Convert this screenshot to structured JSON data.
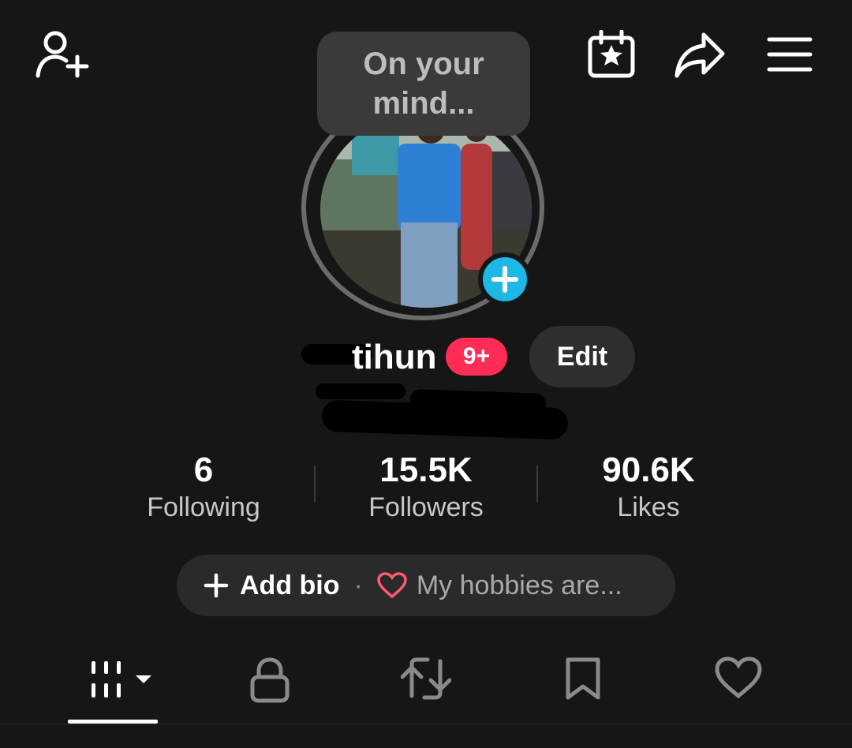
{
  "top_bar": {
    "add_friend_icon": "person-plus-icon",
    "calendar_icon": "calendar-star-icon",
    "share_icon": "share-arrow-icon",
    "menu_icon": "hamburger-menu-icon"
  },
  "note_bubble": {
    "line1": "On your",
    "line2": "mind..."
  },
  "avatar": {
    "add_icon": "plus-icon",
    "add_color": "#1db8e6"
  },
  "profile": {
    "name_visible": "tihun",
    "notification_badge": "9+",
    "badge_color": "#ff2c55",
    "edit_label": "Edit"
  },
  "stats": [
    {
      "value": "6",
      "label": "Following"
    },
    {
      "value": "15.5K",
      "label": "Followers"
    },
    {
      "value": "90.6K",
      "label": "Likes"
    }
  ],
  "bio": {
    "add_label": "Add bio",
    "separator": "·",
    "hobbies_text": "My hobbies are...",
    "heart_color": "#ff5a6e"
  },
  "tabs": [
    {
      "name": "videos-grid",
      "icon": "grid-bars-icon",
      "active": true
    },
    {
      "name": "private",
      "icon": "lock-icon",
      "active": false
    },
    {
      "name": "reposts",
      "icon": "repost-icon",
      "active": false
    },
    {
      "name": "favorites",
      "icon": "bookmark-icon",
      "active": false
    },
    {
      "name": "liked",
      "icon": "heart-icon",
      "active": false
    }
  ]
}
